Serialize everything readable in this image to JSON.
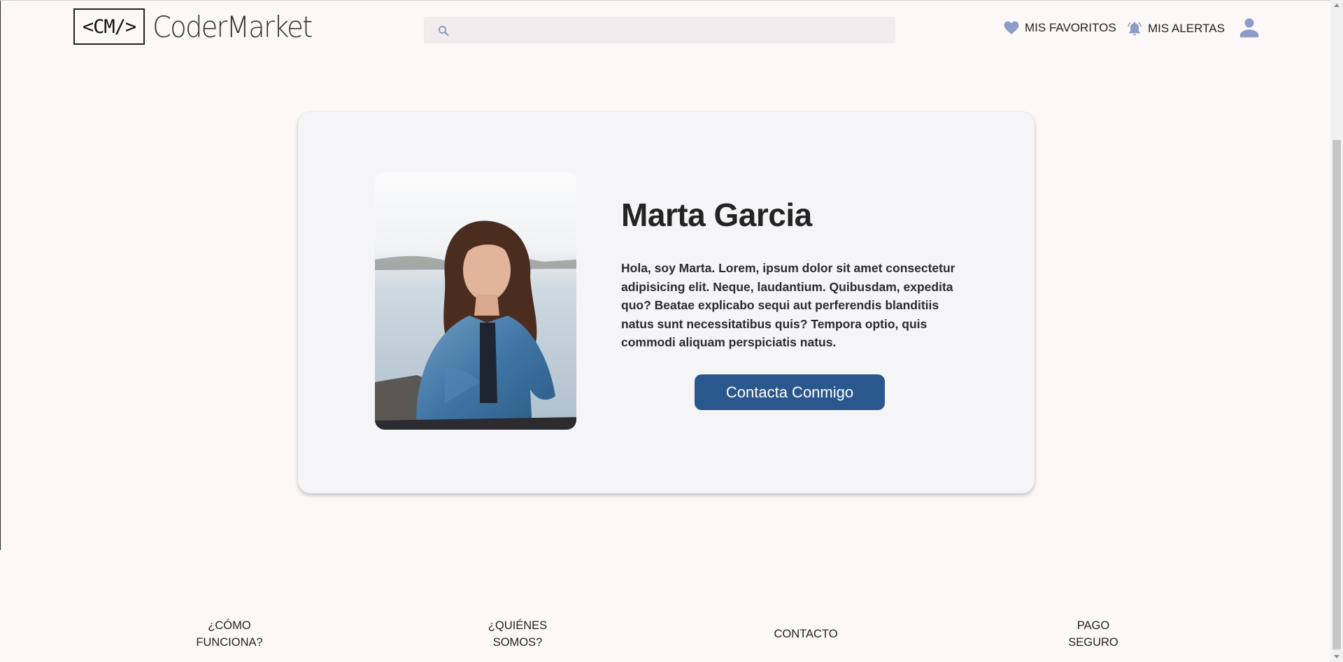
{
  "header": {
    "logo_mark": "<CM/>",
    "logo_text": "CoderMarket",
    "search": {
      "placeholder": "",
      "value": ""
    },
    "favorites_label": "MIS FAVORITOS",
    "alerts_label": "MIS ALERTAS"
  },
  "profile": {
    "name": "Marta Garcia",
    "bio": "Hola, soy Marta. Lorem, ipsum dolor sit amet consectetur adipisicing elit. Neque, laudantium. Quibusdam, expedita quo? Beatae explicabo sequi aut perferendis blanditiis natus sunt necessitatibus quis? Tempora optio, quis commodi aliquam perspiciatis natus.",
    "contact_button": "Contacta Conmigo"
  },
  "footer": {
    "links": [
      "¿CÓMO\nFUNCIONA?",
      "¿QUIÉNES\nSOMOS?",
      "CONTACTO",
      "PAGO\nSEGURO"
    ]
  },
  "icons": {
    "search": "search-icon",
    "favorites": "heart-icon",
    "alerts": "bell-icon",
    "user": "user-icon"
  },
  "colors": {
    "background": "#fcf8f7",
    "card": "#f5f4f6",
    "accent_button": "#2a578c",
    "icon": "#8c9bc7",
    "search_bg": "#f3ecef"
  }
}
